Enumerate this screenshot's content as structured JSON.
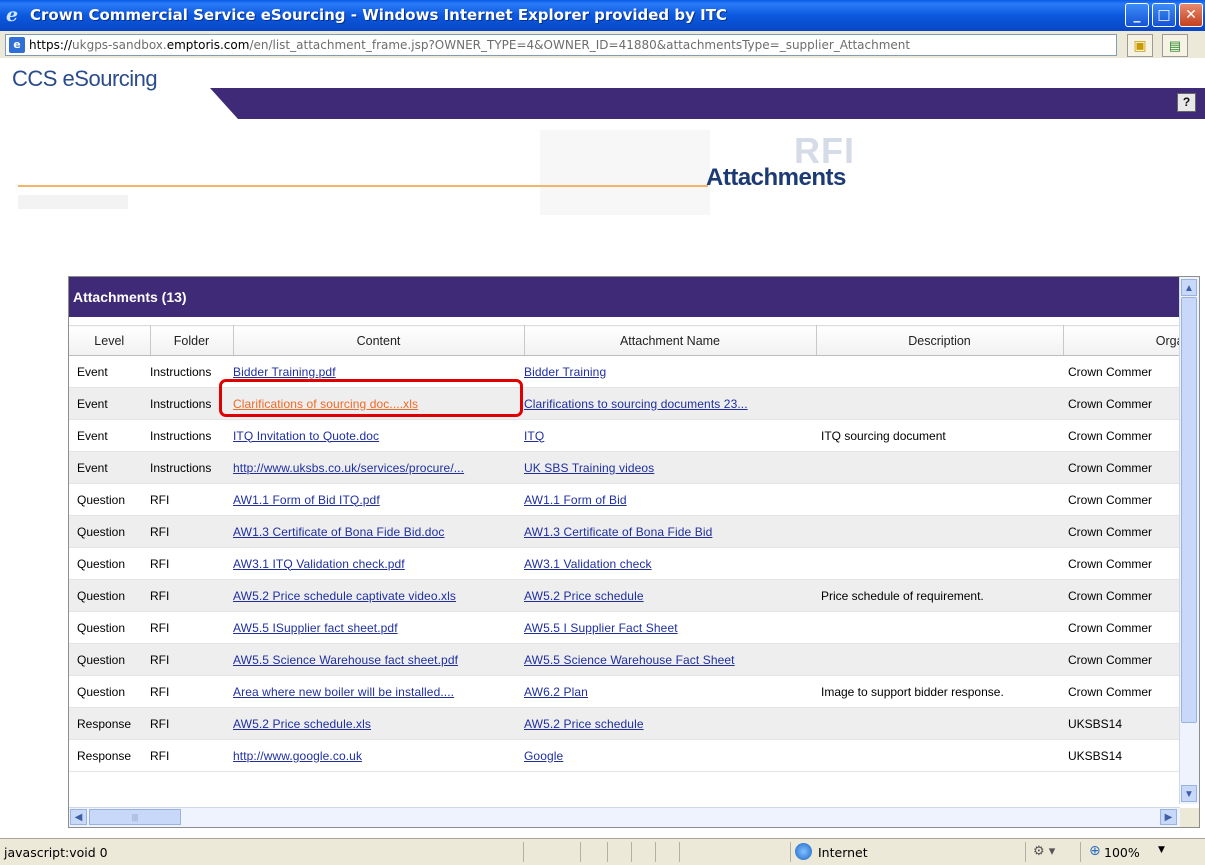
{
  "window": {
    "title": "Crown Commercial Service eSourcing - Windows Internet Explorer provided by ITC",
    "minimize": "_",
    "maximize": "□",
    "close": "✕"
  },
  "address": {
    "prefix": "https://",
    "host_pre": "ukgps-sandbox.",
    "host_main": "emptoris.com",
    "path": "/en/list_attachment_frame.jsp?OWNER_TYPE=4&OWNER_ID=41880&attachmentsType=_supplier_Attachment"
  },
  "app": {
    "logo": "CCS eSourcing",
    "help": "?",
    "watermark": "RFI",
    "page_title": "Attachments"
  },
  "panel": {
    "title": "Attachments (13)"
  },
  "table": {
    "headers": [
      "Level",
      "Folder",
      "Content",
      "Attachment Name",
      "Description",
      "Organiza"
    ],
    "rows": [
      {
        "level": "Event",
        "folder": "Instructions",
        "content": "Bidder Training.pdf",
        "name": "Bidder Training",
        "description": "",
        "org": "Crown Commer"
      },
      {
        "level": "Event",
        "folder": "Instructions",
        "content": "Clarifications of sourcing doc....xls",
        "name": "Clarifications to sourcing documents 23...",
        "description": "",
        "org": "Crown Commer"
      },
      {
        "level": "Event",
        "folder": "Instructions",
        "content": "ITQ Invitation to Quote.doc",
        "name": "ITQ",
        "description": "ITQ sourcing document",
        "org": "Crown Commer"
      },
      {
        "level": "Event",
        "folder": "Instructions",
        "content": "http://www.uksbs.co.uk/services/procure/...",
        "name": "UK SBS Training videos",
        "description": "",
        "org": "Crown Commer"
      },
      {
        "level": "Question",
        "folder": "RFI",
        "content": "AW1.1 Form of Bid ITQ.pdf",
        "name": "AW1.1 Form of Bid",
        "description": "",
        "org": "Crown Commer"
      },
      {
        "level": "Question",
        "folder": "RFI",
        "content": "AW1.3 Certificate of Bona Fide Bid.doc",
        "name": "AW1.3 Certificate of Bona Fide Bid",
        "description": "",
        "org": "Crown Commer"
      },
      {
        "level": "Question",
        "folder": "RFI",
        "content": "AW3.1 ITQ Validation check.pdf",
        "name": "AW3.1 Validation check",
        "description": "",
        "org": "Crown Commer"
      },
      {
        "level": "Question",
        "folder": "RFI",
        "content": "AW5.2 Price schedule captivate video.xls",
        "name": "AW5.2 Price schedule",
        "description": "Price schedule of requirement.",
        "org": "Crown Commer"
      },
      {
        "level": "Question",
        "folder": "RFI",
        "content": "AW5.5 ISupplier fact sheet.pdf",
        "name": "AW5.5 I Supplier Fact Sheet",
        "description": "",
        "org": "Crown Commer"
      },
      {
        "level": "Question",
        "folder": "RFI",
        "content": "AW5.5 Science Warehouse fact sheet.pdf",
        "name": "AW5.5 Science Warehouse Fact Sheet",
        "description": "",
        "org": "Crown Commer"
      },
      {
        "level": "Question",
        "folder": "RFI",
        "content": "Area where new boiler will be installed....",
        "name": "AW6.2 Plan",
        "description": "Image to support bidder response.",
        "org": "Crown Commer"
      },
      {
        "level": "Response",
        "folder": "RFI",
        "content": "AW5.2 Price schedule.xls",
        "name": "AW5.2 Price schedule",
        "description": "",
        "org": "UKSBS14"
      },
      {
        "level": "Response",
        "folder": "RFI",
        "content": "http://www.google.co.uk",
        "name": "Google",
        "description": "",
        "org": "UKSBS14"
      }
    ]
  },
  "status": {
    "text": "javascript:void 0",
    "zone": "Internet",
    "zoom": "100%"
  },
  "colors": {
    "title_bar": "#0b59df",
    "purple_band": "#3f2a78",
    "link": "#1f2f9f",
    "visited_link": "#f06a26",
    "highlight_box": "#e10000"
  }
}
